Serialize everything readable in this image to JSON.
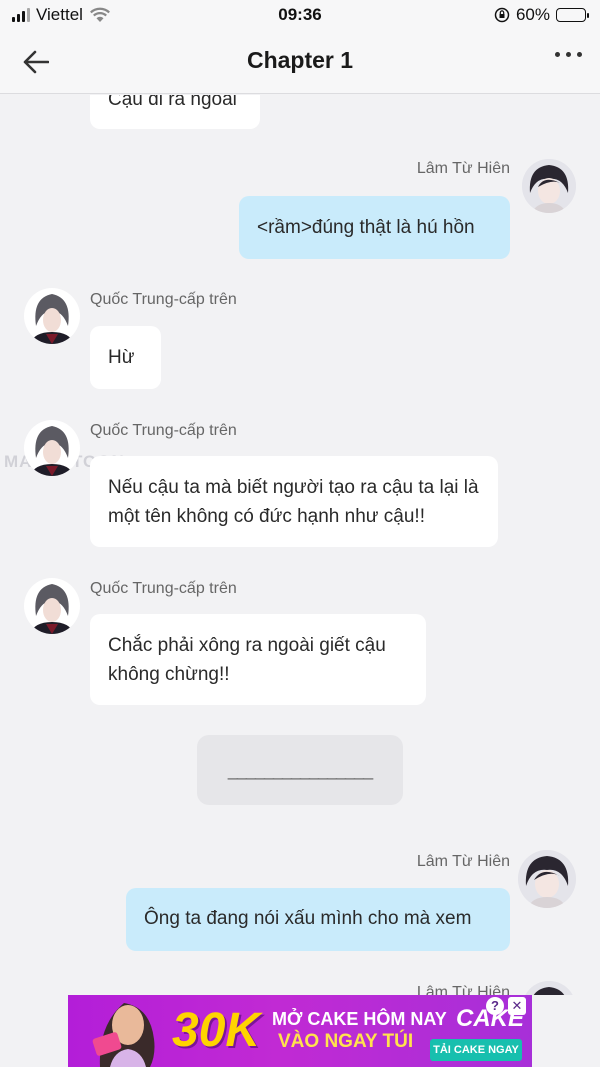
{
  "status_bar": {
    "carrier": "Viettel",
    "time": "09:36",
    "battery_percent": "60%",
    "battery_level": 0.6
  },
  "header": {
    "title": "Chapter 1",
    "back_icon": "arrow-left-icon",
    "more_icon": "more-horizontal-icon"
  },
  "messages": [
    {
      "side": "left",
      "sender": "",
      "text": "Cậu đi ra ngoài"
    },
    {
      "side": "right",
      "sender": "Lâm Từ Hiên",
      "text": "<rầm>đúng thật là hú hồn"
    },
    {
      "side": "left",
      "sender": "Quốc Trung-cấp trên",
      "text": "Hừ"
    },
    {
      "side": "left",
      "sender": "Quốc Trung-cấp trên",
      "text": "Nếu cậu ta mà biết người tạo ra cậu ta lại là một tên không có đức hạnh như cậu!!"
    },
    {
      "side": "left",
      "sender": "Quốc Trung-cấp trên",
      "text": "Chắc phải xông ra ngoài giết cậu không chừng!!"
    },
    {
      "side": "center",
      "sender": "",
      "text": "________________"
    },
    {
      "side": "right",
      "sender": "Lâm Từ Hiên",
      "text": "Ông ta đang nói xấu mình cho mà xem"
    },
    {
      "side": "right",
      "sender": "Lâm Từ Hiên",
      "text": ""
    }
  ],
  "watermark": "MANGATOON",
  "ad": {
    "amount": "30K",
    "line1": "MỞ CAKE HÔM NAY",
    "line2": "VÀO NGAY TÚI",
    "brand": "CAKE",
    "cta": "TẢI CAKE NGAY",
    "help_label": "?",
    "close_label": "✕",
    "colors": {
      "background": "#b31ed8",
      "amount": "#ffd400",
      "cta": "#17bfae"
    }
  },
  "colors": {
    "background": "#f2f2f4",
    "bubble_left": "#ffffff",
    "bubble_right": "#c9ebfb"
  }
}
